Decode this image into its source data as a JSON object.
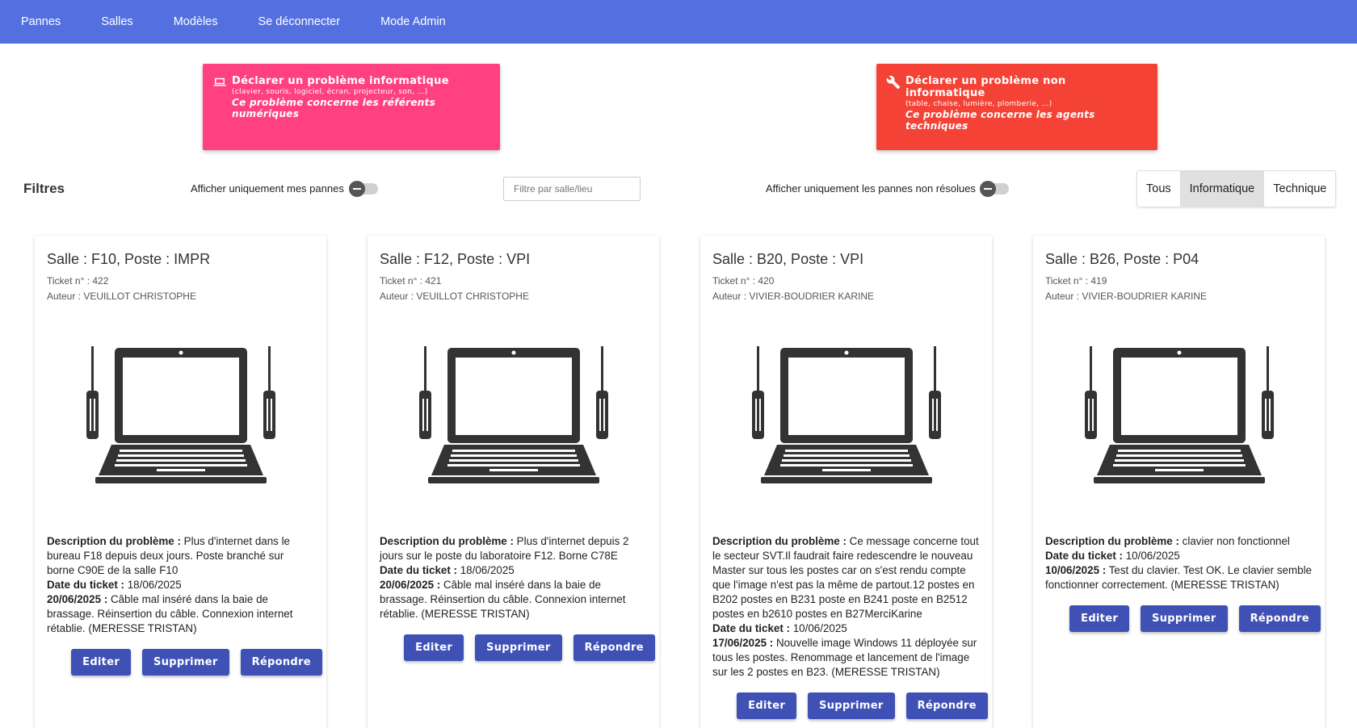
{
  "nav": {
    "items": [
      "Pannes",
      "Salles",
      "Modèles",
      "Se déconnecter",
      "Mode Admin"
    ]
  },
  "declare_info": {
    "icon": "laptop-icon",
    "title": "Déclarer un problème informatique",
    "subtitle": "(clavier, souris, logiciel, écran, projecteur, son, …)",
    "note": "Ce problème concerne les référents numériques",
    "color": "#ff4081"
  },
  "declare_tech": {
    "icon": "wrench-icon",
    "title": "Déclarer un problème non informatique",
    "subtitle": "(table, chaise, lumière, plomberie, …)",
    "note": "Ce problème concerne les agents techniques",
    "color": "#f44336"
  },
  "filters": {
    "title": "Filtres",
    "my_issues_label": "Afficher uniquement mes pannes",
    "location_placeholder": "Filtre par salle/lieu",
    "unresolved_label": "Afficher uniquement les pannes non résolues",
    "categories": [
      "Tous",
      "Informatique",
      "Technique"
    ],
    "active_category": "Informatique"
  },
  "labels": {
    "description": "Description du problème :",
    "date": "Date du ticket :",
    "edit": "Editer",
    "delete": "Supprimer",
    "reply": "Répondre"
  },
  "tickets": [
    {
      "title": "Salle : F10, Poste : IMPR",
      "ticket": "Ticket n° : 422",
      "author": "Auteur : VEUILLOT CHRISTOPHE",
      "description": "Plus d'internet dans le bureau F18 depuis deux jours. Poste branché sur borne C90E de la salle F10",
      "date": "18/06/2025",
      "reply_date": "20/06/2025 :",
      "reply_text": "Câble mal inséré dans la baie de brassage. Réinsertion du câble. Connexion internet rétablie. (MERESSE TRISTAN)"
    },
    {
      "title": "Salle : F12, Poste : VPI",
      "ticket": "Ticket n° : 421",
      "author": "Auteur : VEUILLOT CHRISTOPHE",
      "description": "Plus d'internet depuis 2 jours sur le poste du laboratoire F12. Borne C78E",
      "date": "18/06/2025",
      "reply_date": "20/06/2025 :",
      "reply_text": "Câble mal inséré dans la baie de brassage. Réinsertion du câble. Connexion internet rétablie. (MERESSE TRISTAN)"
    },
    {
      "title": "Salle : B20, Poste : VPI",
      "ticket": "Ticket n° : 420",
      "author": "Auteur : VIVIER-BOUDRIER KARINE",
      "description": "Ce message concerne tout le secteur SVT.Il faudrait faire redescendre le nouveau Master sur tous les postes car on s'est rendu compte que l'image n'est pas la même de partout.12 postes en B202 postes en B231 poste en B241 poste en B2512 postes en b2610 postes en B27MerciKarine",
      "date": "10/06/2025",
      "reply_date": "17/06/2025 :",
      "reply_text": "Nouvelle image Windows 11 déployée sur tous les postes. Renommage et lancement de l'image sur les 2 postes en B23. (MERESSE TRISTAN)"
    },
    {
      "title": "Salle : B26, Poste : P04",
      "ticket": "Ticket n° : 419",
      "author": "Auteur : VIVIER-BOUDRIER KARINE",
      "description": "clavier non fonctionnel",
      "date": "10/06/2025",
      "reply_date": "10/06/2025 :",
      "reply_text": "Test du clavier. Test OK. Le clavier semble fonctionner correctement. (MERESSE TRISTAN)"
    }
  ]
}
